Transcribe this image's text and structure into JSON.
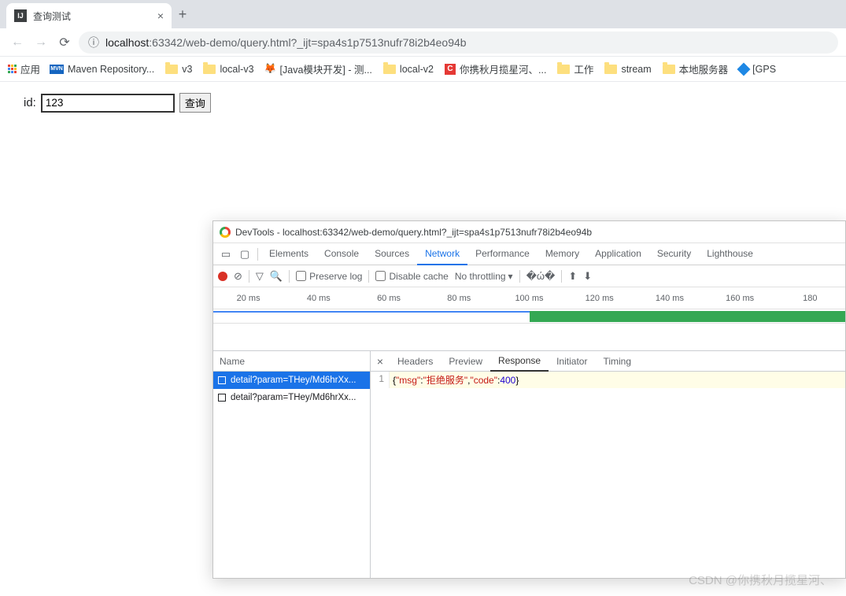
{
  "browser": {
    "tab_title": "查询测试",
    "url_prefix": "localhost",
    "url_path": ":63342/web-demo/query.html?_ijt=spa4s1p7513nufr78i2b4eo94b"
  },
  "bookmarks": {
    "apps": "应用",
    "items": [
      {
        "icon": "mvn",
        "label": "Maven Repository..."
      },
      {
        "icon": "folder",
        "label": "v3"
      },
      {
        "icon": "folder",
        "label": "local-v3"
      },
      {
        "icon": "fox",
        "label": "[Java模块开发] - 测..."
      },
      {
        "icon": "folder",
        "label": "local-v2"
      },
      {
        "icon": "c",
        "label": "你携秋月揽星河、..."
      },
      {
        "icon": "folder",
        "label": "工作"
      },
      {
        "icon": "folder",
        "label": "stream"
      },
      {
        "icon": "folder",
        "label": "本地服务器"
      },
      {
        "icon": "diamond",
        "label": "[GPS"
      }
    ]
  },
  "page": {
    "label": "id:",
    "value": "123",
    "button": "查询"
  },
  "devtools": {
    "title": "DevTools - localhost:63342/web-demo/query.html?_ijt=spa4s1p7513nufr78i2b4eo94b",
    "tabs": [
      "Elements",
      "Console",
      "Sources",
      "Network",
      "Performance",
      "Memory",
      "Application",
      "Security",
      "Lighthouse"
    ],
    "tabs_active": "Network",
    "toolbar": {
      "preserve_log": "Preserve log",
      "disable_cache": "Disable cache",
      "throttling": "No throttling"
    },
    "timeline_labels": [
      "20 ms",
      "40 ms",
      "60 ms",
      "80 ms",
      "100 ms",
      "120 ms",
      "140 ms",
      "160 ms",
      "180"
    ],
    "requests_header": "Name",
    "requests": [
      "detail?param=THey/Md6hrXx...",
      "detail?param=THey/Md6hrXx..."
    ],
    "selected_request": 0,
    "detail_tabs": [
      "Headers",
      "Preview",
      "Response",
      "Initiator",
      "Timing"
    ],
    "detail_active": "Response",
    "response_line_no": "1",
    "response": {
      "msg": "拒绝服务",
      "code": 400
    }
  },
  "watermark": "CSDN @你携秋月揽星河、"
}
